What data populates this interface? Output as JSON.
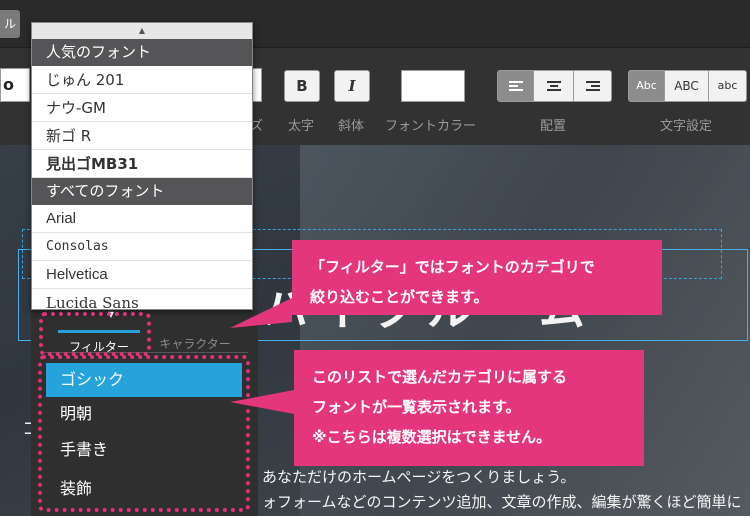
{
  "toolbar": {
    "close_tab_label": "ル",
    "font_input_value": "o",
    "bold_label": "B",
    "italic_label": "I",
    "labels": {
      "partial": "ズ",
      "bold": "太字",
      "italic": "斜体",
      "font_color": "フォントカラー",
      "alignment": "配置",
      "text_setting": "文字設定"
    },
    "text_case": [
      "Abc",
      "ABC",
      "abc"
    ]
  },
  "font_dropdown": {
    "popular_header": "人気のフォント",
    "popular_fonts": [
      "じゅん 201",
      "ナウ-GM",
      "新ゴ R",
      "見出ゴMB31"
    ],
    "all_header": "すべてのフォント",
    "all_fonts": [
      "Arial",
      "Consolas",
      "Helvetica",
      "Lucida Sans"
    ]
  },
  "tabs": {
    "filter": "フィルター",
    "character": "キャラクター"
  },
  "categories": {
    "items": [
      "ゴシック",
      "明朝",
      "手書き",
      "装飾"
    ],
    "selected": "ゴシック"
  },
  "canvas": {
    "title_partial": "ハイクル　ム",
    "line1": "あなただけのホームページをつくりましょう。",
    "line2": "ォフォームなどのコンテンツ追加、文章の作成、編集が驚くほど簡単に",
    "left_mark": "コ"
  },
  "callouts": {
    "filter_note": [
      "「フィルター」ではフォントのカテゴリで",
      "絞り込むことができます。"
    ],
    "list_note": [
      "このリストで選んだカテゴリに属する",
      "フォントが一覧表示されます。",
      "※こちらは複数選択はできません。"
    ]
  },
  "colors": {
    "accent_pink": "#e3367d",
    "selected_blue": "#27a3dc"
  }
}
